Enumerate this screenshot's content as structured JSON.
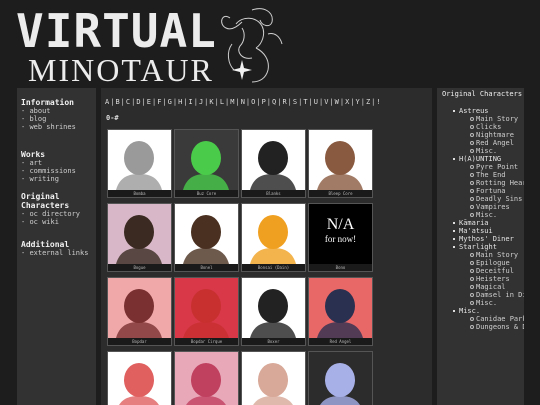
{
  "header": {
    "logo_line1": "VIRTUAL",
    "logo_line2": "MINOTAUR"
  },
  "sidebar": {
    "sections": [
      {
        "heading": "Information",
        "links": [
          "about",
          "blog",
          "web shrines"
        ]
      },
      {
        "heading": "Works",
        "links": [
          "art",
          "commissions",
          "writing"
        ]
      },
      {
        "heading": "Original Characters",
        "links": [
          "oc directory",
          "oc wiki"
        ]
      },
      {
        "heading": "Additional",
        "links": [
          "external links"
        ]
      }
    ]
  },
  "main": {
    "alphabet": [
      "A",
      "B",
      "C",
      "D",
      "E",
      "F",
      "G",
      "H",
      "I",
      "J",
      "K",
      "L",
      "M",
      "N",
      "O",
      "P",
      "Q",
      "R",
      "S",
      "T",
      "U",
      "V",
      "W",
      "X",
      "Y",
      "Z",
      "!"
    ],
    "section_label": "0-#",
    "cards": [
      {
        "label": "Bomba",
        "placeholder": "",
        "bg": "#ffffff"
      },
      {
        "label": "Buz Core",
        "placeholder": "",
        "bg": "#3a3a3a"
      },
      {
        "label": "Blanks",
        "placeholder": "",
        "bg": "#ffffff"
      },
      {
        "label": "Bleep Core",
        "placeholder": "",
        "bg": "#ffffff"
      },
      {
        "label": "Bogue",
        "placeholder": "",
        "bg": "#d8b8c8"
      },
      {
        "label": "Bonel",
        "placeholder": "",
        "bg": "#ffffff"
      },
      {
        "label": "Bonsai (Dain)",
        "placeholder": "",
        "bg": "#ffffff"
      },
      {
        "label": "Bono",
        "placeholder": "N/A\nfor now!",
        "bg": "#000000"
      },
      {
        "label": "Bopdar",
        "placeholder": "",
        "bg": "#f0a8a8"
      },
      {
        "label": "Bopdar Cirque",
        "placeholder": "",
        "bg": "#d83848"
      },
      {
        "label": "Boxer",
        "placeholder": "",
        "bg": "#ffffff"
      },
      {
        "label": "Red Angel",
        "placeholder": "",
        "bg": "#e86868"
      },
      {
        "label": "",
        "placeholder": "",
        "bg": "#ffffff"
      },
      {
        "label": "",
        "placeholder": "",
        "bg": "#e8a8b8"
      },
      {
        "label": "",
        "placeholder": "",
        "bg": "#ffffff"
      },
      {
        "label": "",
        "placeholder": "",
        "bg": "#2c2c2c"
      }
    ]
  },
  "right_sidebar": {
    "title": "Original Characters",
    "tree": [
      {
        "label": "Astreus",
        "children": [
          "Main Story",
          "Clicks",
          "Nightmare",
          "Red Angel",
          "Misc."
        ]
      },
      {
        "label": "H(A)UNTING",
        "children": [
          "Pyre Point",
          "The End",
          "Rotting Heartz",
          "Fortuna",
          "Deadly Sins",
          "Vampires",
          "Misc."
        ]
      },
      {
        "label": "Kāmaria",
        "children": []
      },
      {
        "label": "Ma'atsui",
        "children": []
      },
      {
        "label": "Mythos' Diner",
        "children": []
      },
      {
        "label": "Starlight",
        "children": [
          "Main Story",
          "Epilogue",
          "Deceitful",
          "Heisters",
          "Magical",
          "Damsel in Distress",
          "Misc."
        ]
      },
      {
        "label": "Misc.",
        "children": [
          "Canidae Park",
          "Dungeons & Dragons"
        ]
      }
    ]
  },
  "colors": {
    "page_bg": "#1d1d1d",
    "panel_bg": "#323232",
    "main_bg": "#2c2c2c",
    "text": "#dddddd"
  },
  "icons": {
    "logo_art": "minotaur-sketch-icon",
    "sparkle": "sparkle-icon"
  }
}
